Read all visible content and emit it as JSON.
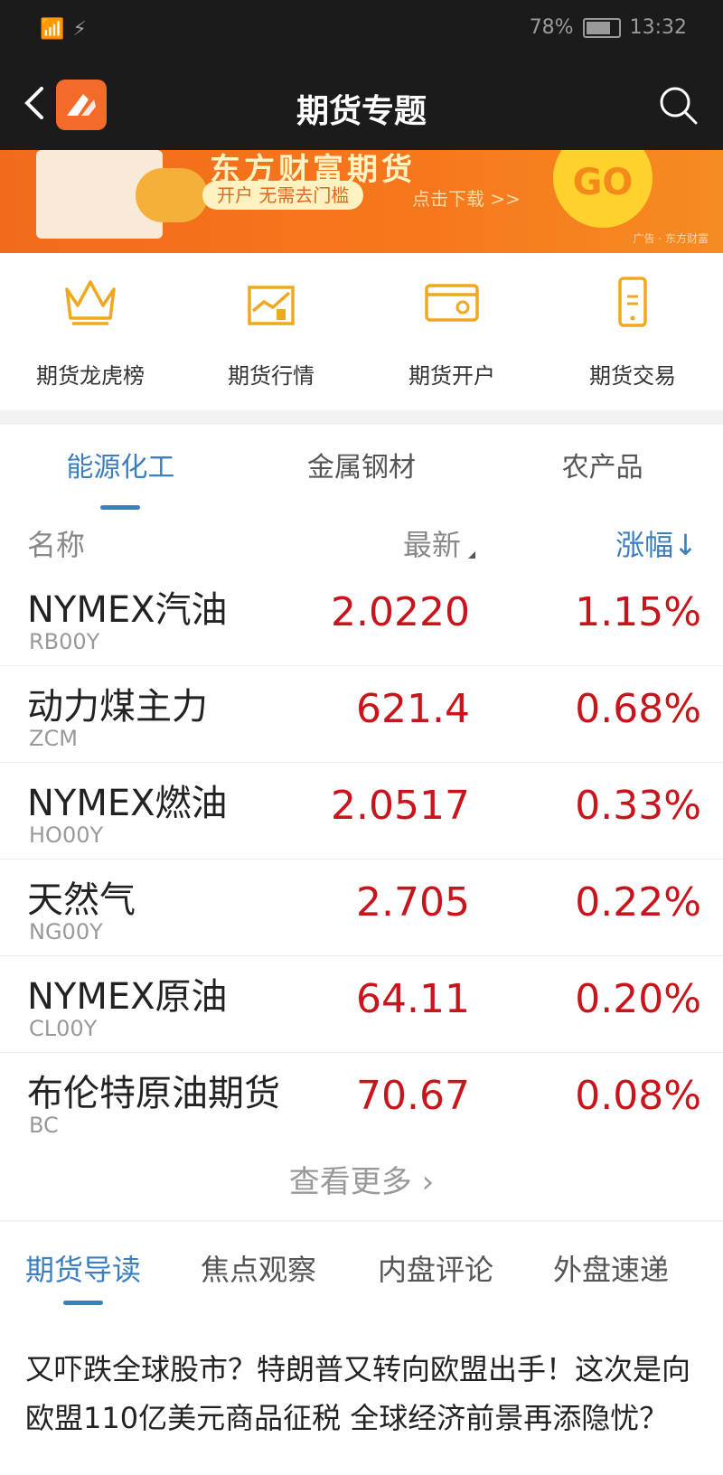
{
  "status_bar": {
    "left": "📶 ⚡",
    "battery": "78%",
    "time": "13:32"
  },
  "nav": {
    "title": "期货专题"
  },
  "banner": {
    "headline": "东方财富期货",
    "pill": "开户 无需去门槛",
    "sub": "点击下载 >>",
    "go": "GO",
    "ad": "广告 · 东方财富"
  },
  "quick": [
    {
      "label": "期货龙虎榜",
      "icon": "crown-icon"
    },
    {
      "label": "期货行情",
      "icon": "chart-icon"
    },
    {
      "label": "期货开户",
      "icon": "card-icon"
    },
    {
      "label": "期货交易",
      "icon": "phone-trade-icon"
    }
  ],
  "tabs": [
    "能源化工",
    "金属钢材",
    "农产品"
  ],
  "table_header": {
    "name": "名称",
    "latest": "最新",
    "change": "涨幅↓"
  },
  "rows": [
    {
      "name": "NYMEX汽油",
      "code": "RB00Y",
      "price": "2.0220",
      "change": "1.15%"
    },
    {
      "name": "动力煤主力",
      "code": "ZCM",
      "price": "621.4",
      "change": "0.68%"
    },
    {
      "name": "NYMEX燃油",
      "code": "HO00Y",
      "price": "2.0517",
      "change": "0.33%"
    },
    {
      "name": "天然气",
      "code": "NG00Y",
      "price": "2.705",
      "change": "0.22%"
    },
    {
      "name": "NYMEX原油",
      "code": "CL00Y",
      "price": "64.11",
      "change": "0.20%"
    },
    {
      "name": "布伦特原油期货",
      "code": "BC",
      "price": "70.67",
      "change": "0.08%"
    }
  ],
  "more": "查看更多 ›",
  "news_tabs": [
    "期货导读",
    "焦点观察",
    "内盘评论",
    "外盘速递"
  ],
  "news_headline": "又吓跌全球股市？特朗普又转向欧盟出手！这次是向欧盟110亿美元商品征税 全球经济前景再添隐忧？",
  "colors": {
    "accent": "#3c7fc1",
    "up": "#c8151b",
    "brand": "#f36a2a"
  }
}
